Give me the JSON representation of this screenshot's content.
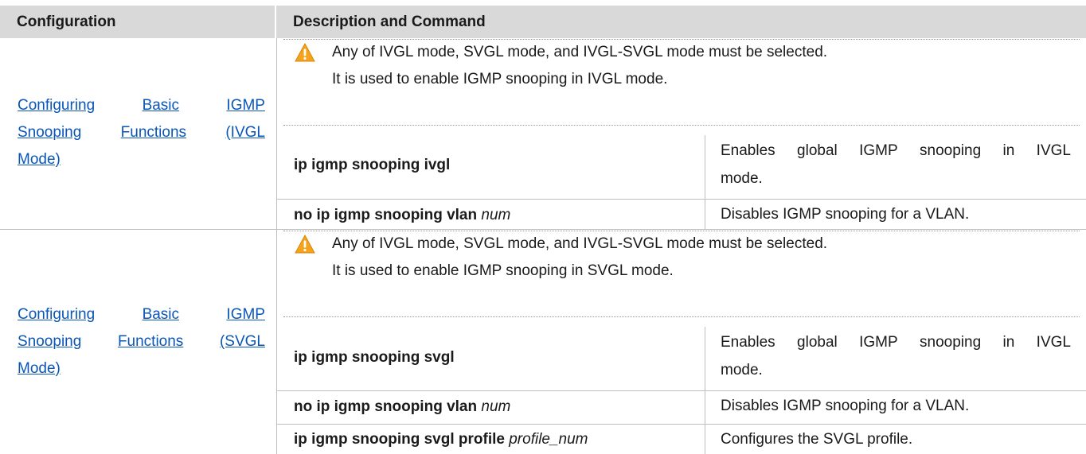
{
  "table": {
    "headers": [
      "Configuration",
      "Description and Command"
    ],
    "sections": [
      {
        "config_link_lines": [
          "Configuring Basic IGMP",
          "Snooping Functions (IVGL",
          "Mode)"
        ],
        "notes": [
          "Any of IVGL mode, SVGL mode, and IVGL-SVGL mode must be selected.",
          "It is used to enable IGMP snooping in IVGL mode."
        ],
        "commands": [
          {
            "bold": "ip igmp snooping ivgl",
            "italic": "",
            "desc_lines": [
              "Enables global IGMP snooping in IVGL",
              "mode."
            ]
          },
          {
            "bold": "no ip igmp snooping vlan",
            "italic": "num",
            "desc_lines": [
              "Disables IGMP snooping for a VLAN."
            ]
          }
        ]
      },
      {
        "config_link_lines": [
          "Configuring Basic IGMP",
          "Snooping Functions (SVGL",
          "Mode)"
        ],
        "notes": [
          "Any of IVGL mode, SVGL mode, and IVGL-SVGL mode must be selected.",
          "It is used to enable IGMP snooping in SVGL mode."
        ],
        "commands": [
          {
            "bold": "ip igmp snooping svgl",
            "italic": "",
            "desc_lines": [
              "Enables global IGMP snooping in IVGL",
              "mode."
            ]
          },
          {
            "bold": "no ip igmp snooping vlan",
            "italic": "num",
            "desc_lines": [
              "Disables IGMP snooping for a VLAN."
            ]
          },
          {
            "bold": "ip igmp snooping svgl profile",
            "italic": "profile_num",
            "desc_lines": [
              "Configures the SVGL profile."
            ]
          }
        ]
      }
    ]
  },
  "colors": {
    "header_bg": "#d9d9d9",
    "link": "#0a56b8",
    "warning": "#f5a31a",
    "grid": "#bfbfbf"
  },
  "icons": {
    "note": "warning-icon"
  }
}
